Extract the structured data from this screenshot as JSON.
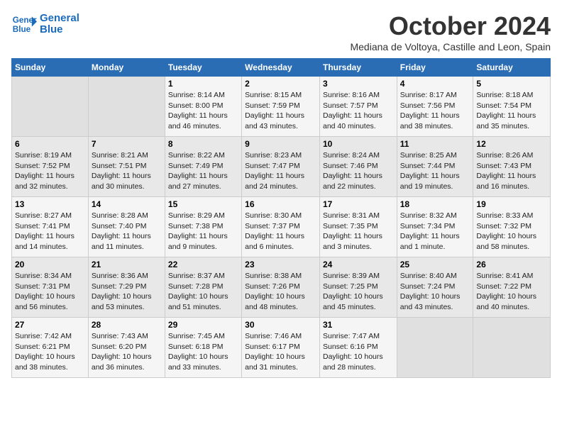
{
  "header": {
    "logo": {
      "line1": "General",
      "line2": "Blue"
    },
    "month": "October 2024",
    "location": "Mediana de Voltoya, Castille and Leon, Spain"
  },
  "weekdays": [
    "Sunday",
    "Monday",
    "Tuesday",
    "Wednesday",
    "Thursday",
    "Friday",
    "Saturday"
  ],
  "weeks": [
    [
      {
        "day": "",
        "info": ""
      },
      {
        "day": "",
        "info": ""
      },
      {
        "day": "1",
        "info": "Sunrise: 8:14 AM\nSunset: 8:00 PM\nDaylight: 11 hours\nand 46 minutes."
      },
      {
        "day": "2",
        "info": "Sunrise: 8:15 AM\nSunset: 7:59 PM\nDaylight: 11 hours\nand 43 minutes."
      },
      {
        "day": "3",
        "info": "Sunrise: 8:16 AM\nSunset: 7:57 PM\nDaylight: 11 hours\nand 40 minutes."
      },
      {
        "day": "4",
        "info": "Sunrise: 8:17 AM\nSunset: 7:56 PM\nDaylight: 11 hours\nand 38 minutes."
      },
      {
        "day": "5",
        "info": "Sunrise: 8:18 AM\nSunset: 7:54 PM\nDaylight: 11 hours\nand 35 minutes."
      }
    ],
    [
      {
        "day": "6",
        "info": "Sunrise: 8:19 AM\nSunset: 7:52 PM\nDaylight: 11 hours\nand 32 minutes."
      },
      {
        "day": "7",
        "info": "Sunrise: 8:21 AM\nSunset: 7:51 PM\nDaylight: 11 hours\nand 30 minutes."
      },
      {
        "day": "8",
        "info": "Sunrise: 8:22 AM\nSunset: 7:49 PM\nDaylight: 11 hours\nand 27 minutes."
      },
      {
        "day": "9",
        "info": "Sunrise: 8:23 AM\nSunset: 7:47 PM\nDaylight: 11 hours\nand 24 minutes."
      },
      {
        "day": "10",
        "info": "Sunrise: 8:24 AM\nSunset: 7:46 PM\nDaylight: 11 hours\nand 22 minutes."
      },
      {
        "day": "11",
        "info": "Sunrise: 8:25 AM\nSunset: 7:44 PM\nDaylight: 11 hours\nand 19 minutes."
      },
      {
        "day": "12",
        "info": "Sunrise: 8:26 AM\nSunset: 7:43 PM\nDaylight: 11 hours\nand 16 minutes."
      }
    ],
    [
      {
        "day": "13",
        "info": "Sunrise: 8:27 AM\nSunset: 7:41 PM\nDaylight: 11 hours\nand 14 minutes."
      },
      {
        "day": "14",
        "info": "Sunrise: 8:28 AM\nSunset: 7:40 PM\nDaylight: 11 hours\nand 11 minutes."
      },
      {
        "day": "15",
        "info": "Sunrise: 8:29 AM\nSunset: 7:38 PM\nDaylight: 11 hours\nand 9 minutes."
      },
      {
        "day": "16",
        "info": "Sunrise: 8:30 AM\nSunset: 7:37 PM\nDaylight: 11 hours\nand 6 minutes."
      },
      {
        "day": "17",
        "info": "Sunrise: 8:31 AM\nSunset: 7:35 PM\nDaylight: 11 hours\nand 3 minutes."
      },
      {
        "day": "18",
        "info": "Sunrise: 8:32 AM\nSunset: 7:34 PM\nDaylight: 11 hours\nand 1 minute."
      },
      {
        "day": "19",
        "info": "Sunrise: 8:33 AM\nSunset: 7:32 PM\nDaylight: 10 hours\nand 58 minutes."
      }
    ],
    [
      {
        "day": "20",
        "info": "Sunrise: 8:34 AM\nSunset: 7:31 PM\nDaylight: 10 hours\nand 56 minutes."
      },
      {
        "day": "21",
        "info": "Sunrise: 8:36 AM\nSunset: 7:29 PM\nDaylight: 10 hours\nand 53 minutes."
      },
      {
        "day": "22",
        "info": "Sunrise: 8:37 AM\nSunset: 7:28 PM\nDaylight: 10 hours\nand 51 minutes."
      },
      {
        "day": "23",
        "info": "Sunrise: 8:38 AM\nSunset: 7:26 PM\nDaylight: 10 hours\nand 48 minutes."
      },
      {
        "day": "24",
        "info": "Sunrise: 8:39 AM\nSunset: 7:25 PM\nDaylight: 10 hours\nand 45 minutes."
      },
      {
        "day": "25",
        "info": "Sunrise: 8:40 AM\nSunset: 7:24 PM\nDaylight: 10 hours\nand 43 minutes."
      },
      {
        "day": "26",
        "info": "Sunrise: 8:41 AM\nSunset: 7:22 PM\nDaylight: 10 hours\nand 40 minutes."
      }
    ],
    [
      {
        "day": "27",
        "info": "Sunrise: 7:42 AM\nSunset: 6:21 PM\nDaylight: 10 hours\nand 38 minutes."
      },
      {
        "day": "28",
        "info": "Sunrise: 7:43 AM\nSunset: 6:20 PM\nDaylight: 10 hours\nand 36 minutes."
      },
      {
        "day": "29",
        "info": "Sunrise: 7:45 AM\nSunset: 6:18 PM\nDaylight: 10 hours\nand 33 minutes."
      },
      {
        "day": "30",
        "info": "Sunrise: 7:46 AM\nSunset: 6:17 PM\nDaylight: 10 hours\nand 31 minutes."
      },
      {
        "day": "31",
        "info": "Sunrise: 7:47 AM\nSunset: 6:16 PM\nDaylight: 10 hours\nand 28 minutes."
      },
      {
        "day": "",
        "info": ""
      },
      {
        "day": "",
        "info": ""
      }
    ]
  ]
}
